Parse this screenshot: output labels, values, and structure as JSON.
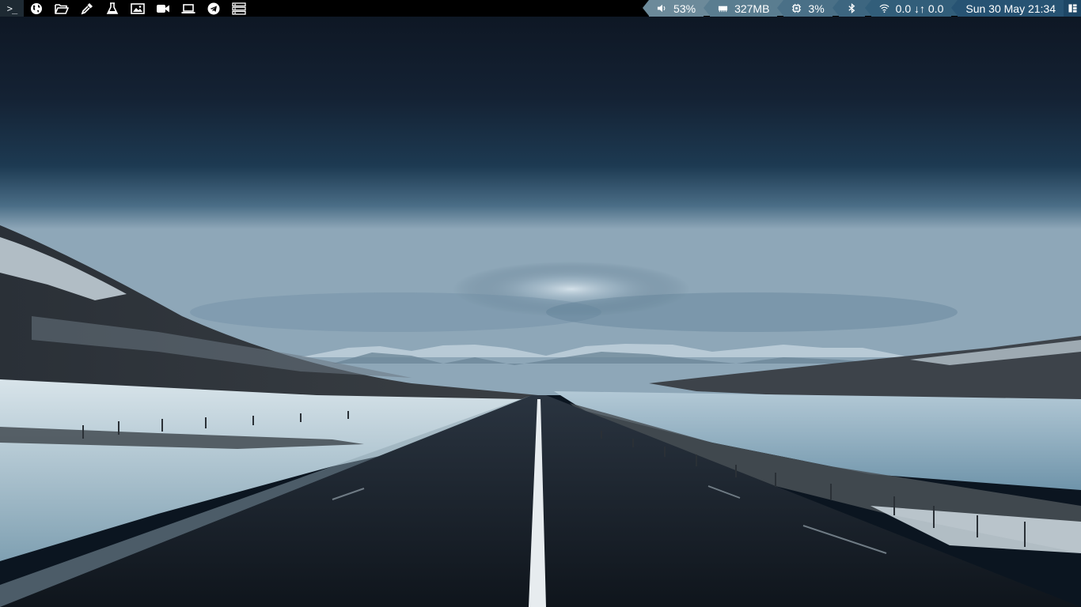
{
  "topbar": {
    "launcher": [
      {
        "name": "terminal",
        "label": ">_"
      },
      {
        "name": "globe-icon"
      },
      {
        "name": "folder-open-icon"
      },
      {
        "name": "eyedropper-icon"
      },
      {
        "name": "flask-icon"
      },
      {
        "name": "image-icon"
      },
      {
        "name": "video-camera-icon"
      },
      {
        "name": "laptop-icon"
      },
      {
        "name": "telegram-icon"
      },
      {
        "name": "server-icon"
      }
    ],
    "status": {
      "volume": "53%",
      "memory": "327MB",
      "cpu": "3%",
      "network": "0.0 ↓↑ 0.0",
      "clock": "Sun 30 May 21:34"
    },
    "colors": {
      "bar_bg": "#000000",
      "seg1": "#6c8a9a",
      "seg2": "#5a7d90",
      "seg3": "#4a7087",
      "seg4": "#3d6680",
      "seg5": "#325e7a",
      "seg6": "#275373"
    }
  }
}
